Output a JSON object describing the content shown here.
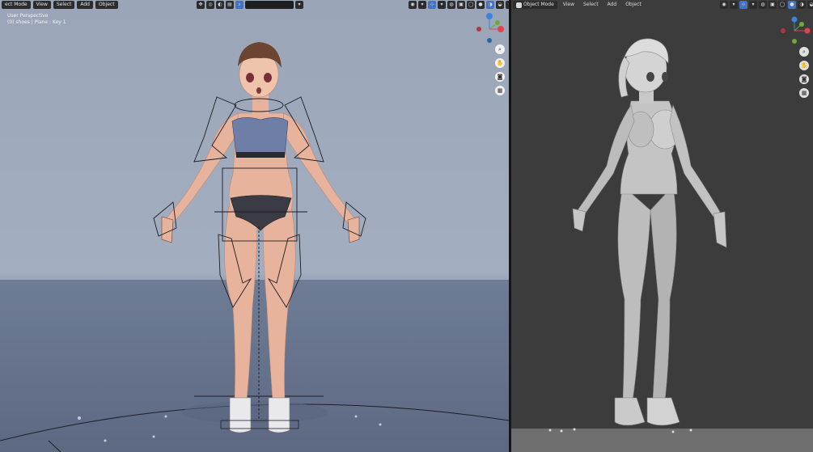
{
  "left_viewport": {
    "header": {
      "mode_label": "ect Mode",
      "menu": [
        "View",
        "Select",
        "Add",
        "Object"
      ],
      "search_text": ""
    },
    "overlay": {
      "perspective": "User Perspective",
      "object_info": "(0) shoes | Plane : Key 1"
    },
    "nav_buttons": [
      "zoom-icon",
      "hand-icon",
      "camera-icon",
      "grid-icon"
    ]
  },
  "right_viewport": {
    "header": {
      "mode_label": "Object Mode",
      "menu": [
        "View",
        "Select",
        "Add",
        "Object"
      ]
    },
    "nav_buttons": [
      "zoom-icon",
      "hand-icon",
      "camera-icon",
      "grid-icon"
    ]
  },
  "colors": {
    "left_bg": "#a1acbe",
    "left_floor": "#6d7a93",
    "right_bg": "#3c3c3c",
    "skin": "#e8b39c",
    "top": "#6e7ea6",
    "gizmo_x": "#e0434f",
    "gizmo_y": "#6fa83a",
    "gizmo_z": "#3c83dc"
  }
}
